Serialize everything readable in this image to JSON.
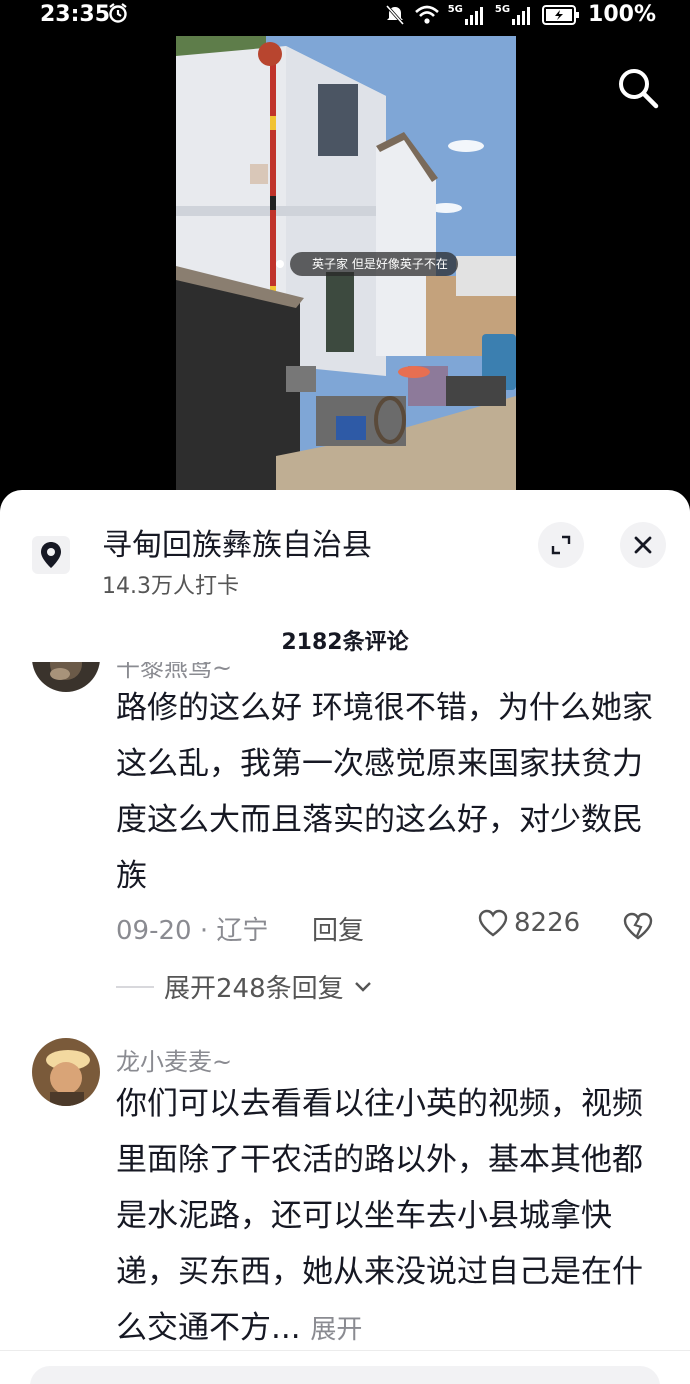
{
  "status_bar": {
    "time": "23:35",
    "battery": "100%",
    "signal_label_1": "5G",
    "signal_label_2": "5G",
    "icons": [
      "alarm-icon",
      "mute-icon",
      "wifi-icon",
      "signal-icon",
      "signal-icon",
      "battery-icon"
    ]
  },
  "video": {
    "caption": "英子家 但是好像英子不在",
    "search_icon": "search-icon"
  },
  "sheet": {
    "location_title": "寻甸回族彝族自治县",
    "location_sub": "14.3万人打卡",
    "comment_count_title": "2182条评论",
    "location_icon": "location-pin-icon",
    "expand_icon": "expand-icon",
    "close_icon": "close-icon"
  },
  "comments": [
    {
      "author": "千黎燕鸢~",
      "text": "路修的这么好 环境很不错，为什么她家这么乱，我第一次感觉原来国家扶贫力度这么大而且落实的这么好，对少数民族",
      "date_location": "09-20 · 辽宁",
      "reply_label": "回复",
      "likes": "8226",
      "expand_replies": "展开248条回复"
    },
    {
      "author": "龙小麦麦~",
      "text": "你们可以去看看以往小英的视频，视频里面除了干农活的路以外，基本其他都是水泥路，还可以坐车去小县城拿快递，买东西，她从来没说过自己是在什么交通不方...",
      "more_label": "展开"
    }
  ],
  "colors": {
    "sheet_bg": "#ffffff",
    "text_primary": "#161823",
    "text_secondary": "#8a8b91"
  }
}
